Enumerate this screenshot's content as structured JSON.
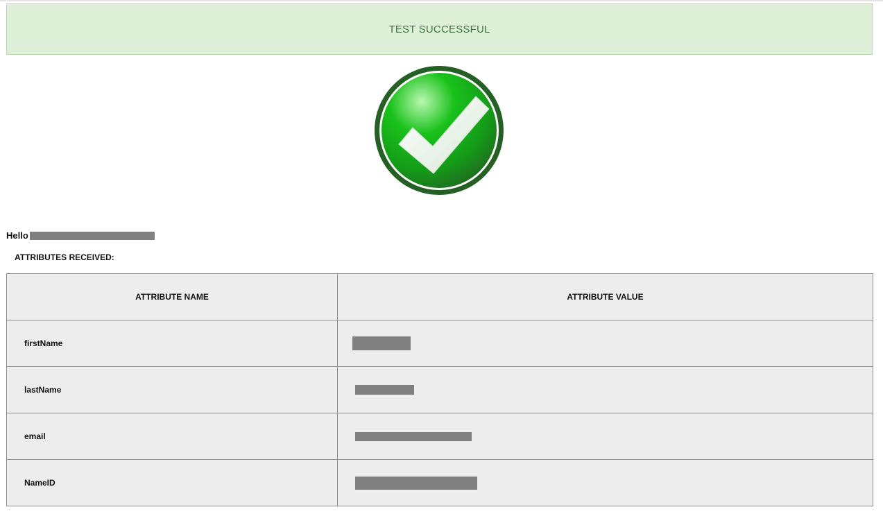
{
  "banner": {
    "text": "TEST SUCCESSFUL"
  },
  "status_icon": "check-circle-icon",
  "greeting": {
    "label": "Hello"
  },
  "attributes": {
    "heading": "ATTRIBUTES RECEIVED:",
    "columns": [
      "ATTRIBUTE NAME",
      "ATTRIBUTE VALUE"
    ],
    "rows": [
      {
        "name": "firstName"
      },
      {
        "name": "lastName"
      },
      {
        "name": "email"
      },
      {
        "name": "NameID"
      }
    ]
  },
  "colors": {
    "banner_bg": "#dff0d8",
    "banner_text": "#3c763d",
    "table_bg": "#ededed",
    "check_green": "#1faa1f"
  }
}
